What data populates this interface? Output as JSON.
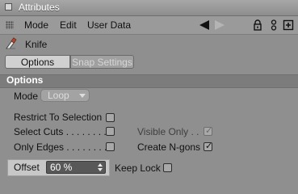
{
  "window": {
    "title": "Attributes"
  },
  "menu": {
    "items": [
      "Mode",
      "Edit",
      "User Data"
    ]
  },
  "tool": {
    "name": "Knife",
    "icon": "knife-tool-icon"
  },
  "tabs": [
    {
      "label": "Options",
      "active": true
    },
    {
      "label": "Snap Settings",
      "active": false
    }
  ],
  "section": {
    "title": "Options"
  },
  "mode": {
    "label": "Mode",
    "value": "Loop"
  },
  "options": {
    "restrict_to_selection": {
      "label": "Restrict To Selection",
      "checked": false
    },
    "select_cuts": {
      "label": "Select Cuts . . . . . . . .",
      "checked": false
    },
    "only_edges": {
      "label": "Only Edges . . . . . . . .",
      "checked": false
    },
    "visible_only": {
      "label": "Visible Only . .",
      "checked": true,
      "disabled": true
    },
    "create_ngons": {
      "label": "Create N-gons",
      "checked": true
    },
    "keep_lock": {
      "label": "Keep Lock",
      "checked": false
    }
  },
  "offset": {
    "label": "Offset",
    "value": "60 %"
  },
  "colors": {
    "panel": "#8f8f8f",
    "section_header": "#7c7c7c",
    "field": "#585858"
  }
}
